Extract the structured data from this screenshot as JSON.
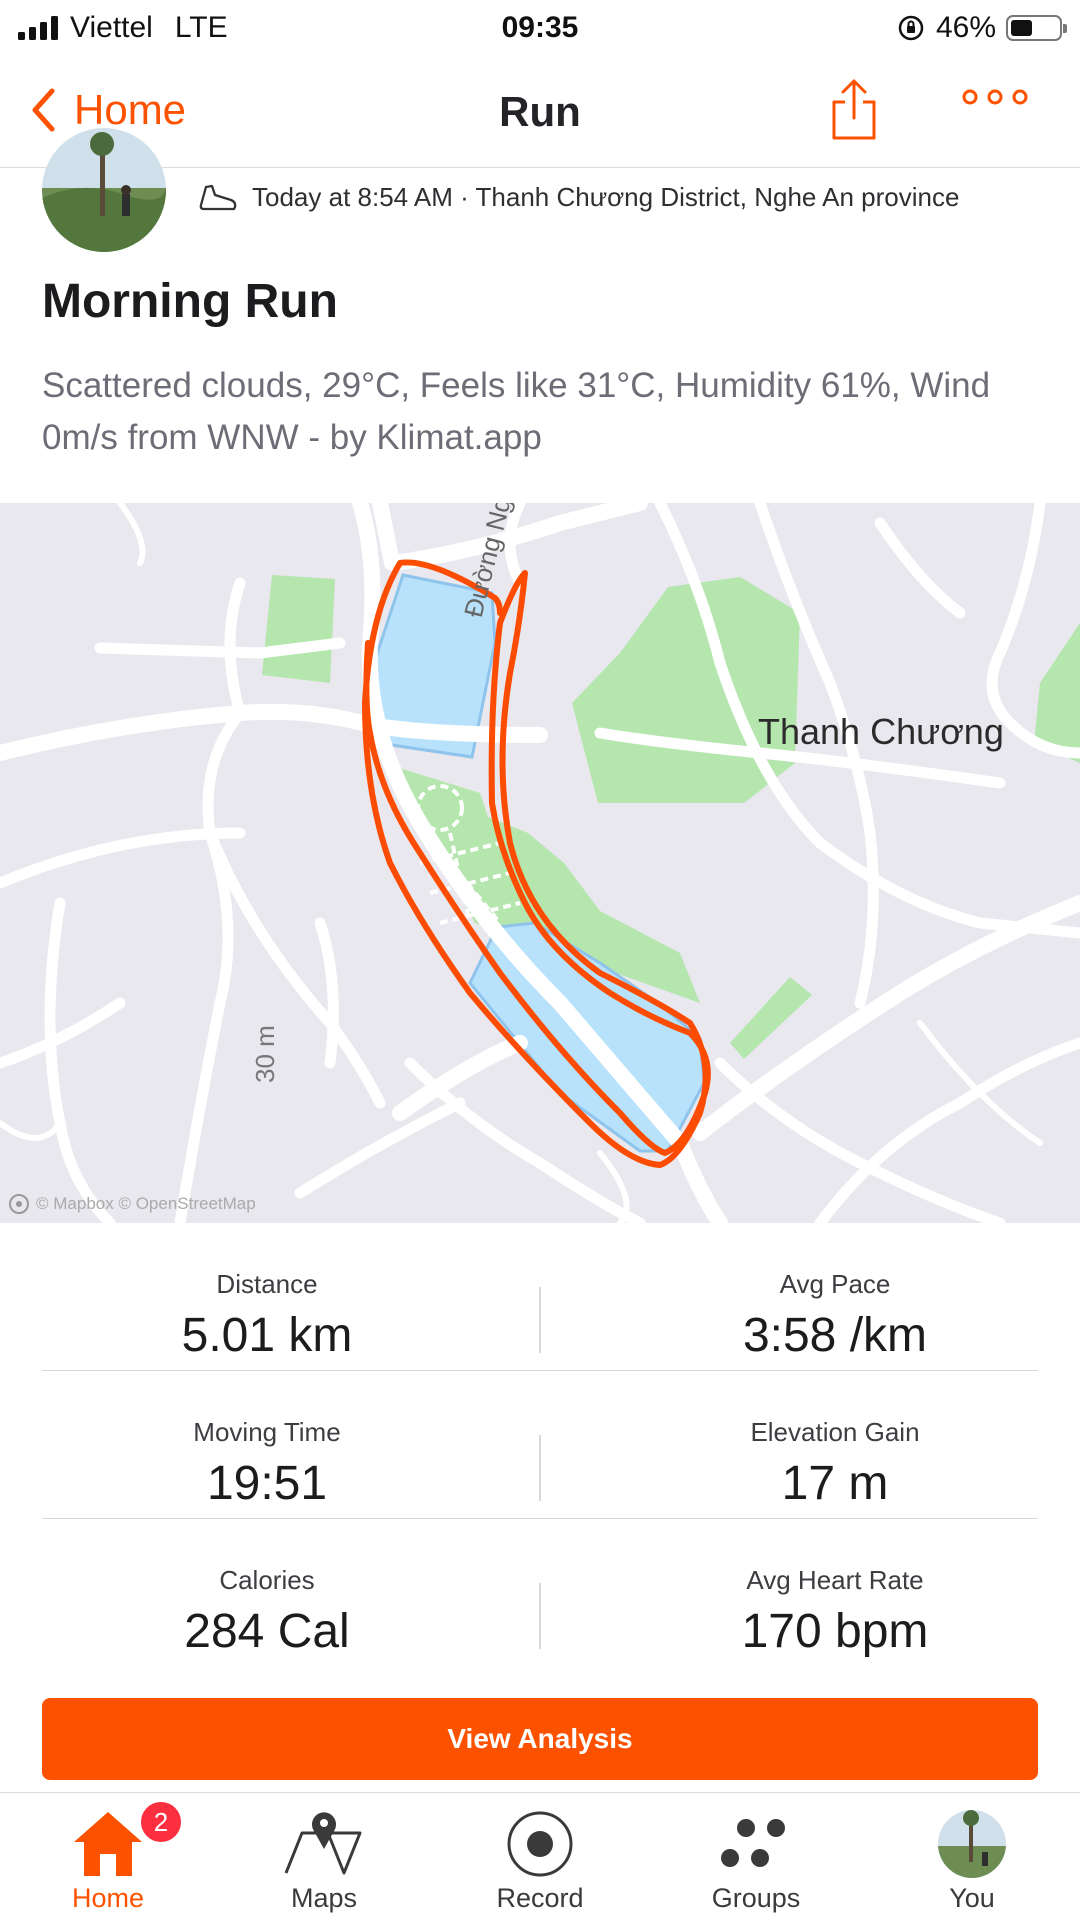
{
  "status_bar": {
    "carrier": "Viettel",
    "network": "LTE",
    "time": "09:35",
    "battery_percent": "46%",
    "battery_level": 0.46
  },
  "nav": {
    "back_label": "Home",
    "title": "Run",
    "back_icon": "chevron-left-icon",
    "share_icon": "share-icon",
    "more_icon": "more-icon",
    "accent_color": "#fc5200"
  },
  "activity": {
    "meta": "Today at 8:54 AM · Thanh Chương District, Nghe An province",
    "title": "Morning Run",
    "description": "Scattered clouds, 29°C, Feels like 31°C, Humidity 61%, Wind 0m/s from WNW - by Klimat.app"
  },
  "map": {
    "place_label": "Thanh Chương",
    "street_label": "Đường Nguyễn",
    "elevation_label": "30 m",
    "attribution": "© Mapbox © OpenStreetMap",
    "route_color": "#fc4c02"
  },
  "stats": [
    {
      "left": {
        "label": "Distance",
        "value": "5.01 km"
      },
      "right": {
        "label": "Avg Pace",
        "value": "3:58 /km"
      }
    },
    {
      "left": {
        "label": "Moving Time",
        "value": "19:51"
      },
      "right": {
        "label": "Elevation Gain",
        "value": "17 m"
      }
    },
    {
      "left": {
        "label": "Calories",
        "value": "284 Cal"
      },
      "right": {
        "label": "Avg Heart Rate",
        "value": "170 bpm"
      }
    }
  ],
  "actions": {
    "view_analysis": "View Analysis"
  },
  "tabs": [
    {
      "label": "Home",
      "icon": "home-icon",
      "active": true,
      "badge": "2"
    },
    {
      "label": "Maps",
      "icon": "map-pin-icon"
    },
    {
      "label": "Record",
      "icon": "record-icon"
    },
    {
      "label": "Groups",
      "icon": "groups-icon"
    },
    {
      "label": "You",
      "icon": "avatar"
    }
  ]
}
